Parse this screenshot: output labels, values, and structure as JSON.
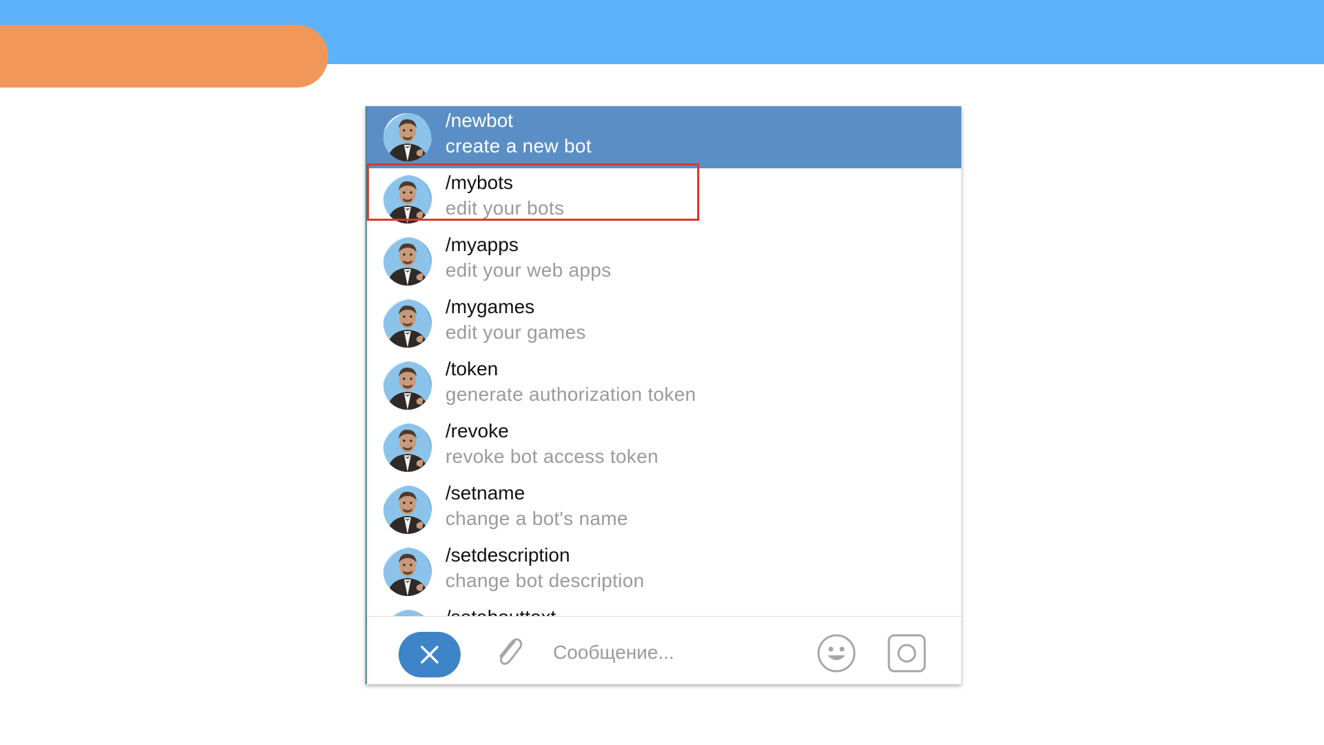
{
  "commands": [
    {
      "command": "/newbot",
      "description": "create a new bot",
      "selected": true
    },
    {
      "command": "/mybots",
      "description": "edit your bots",
      "selected": false
    },
    {
      "command": "/myapps",
      "description": "edit your web apps",
      "selected": false
    },
    {
      "command": "/mygames",
      "description": "edit your games",
      "selected": false
    },
    {
      "command": "/token",
      "description": "generate authorization token",
      "selected": false
    },
    {
      "command": "/revoke",
      "description": "revoke bot access token",
      "selected": false
    },
    {
      "command": "/setname",
      "description": "change a bot's name",
      "selected": false
    },
    {
      "command": "/setdescription",
      "description": "change bot description",
      "selected": false
    },
    {
      "command": "/setabouttext",
      "description": "",
      "selected": false
    }
  ],
  "composer": {
    "placeholder": "Сообщение...",
    "cancel_icon": "close-icon",
    "attach_icon": "paperclip-icon",
    "emoji_icon": "smiley-icon",
    "camera_icon": "camera-icon"
  },
  "colors": {
    "header_band": "#5eb2fa",
    "orange_tab": "#f2975a",
    "selected_row": "#5b8ec4",
    "highlight_border": "#d93a2b",
    "cancel_button": "#3d84c9"
  }
}
